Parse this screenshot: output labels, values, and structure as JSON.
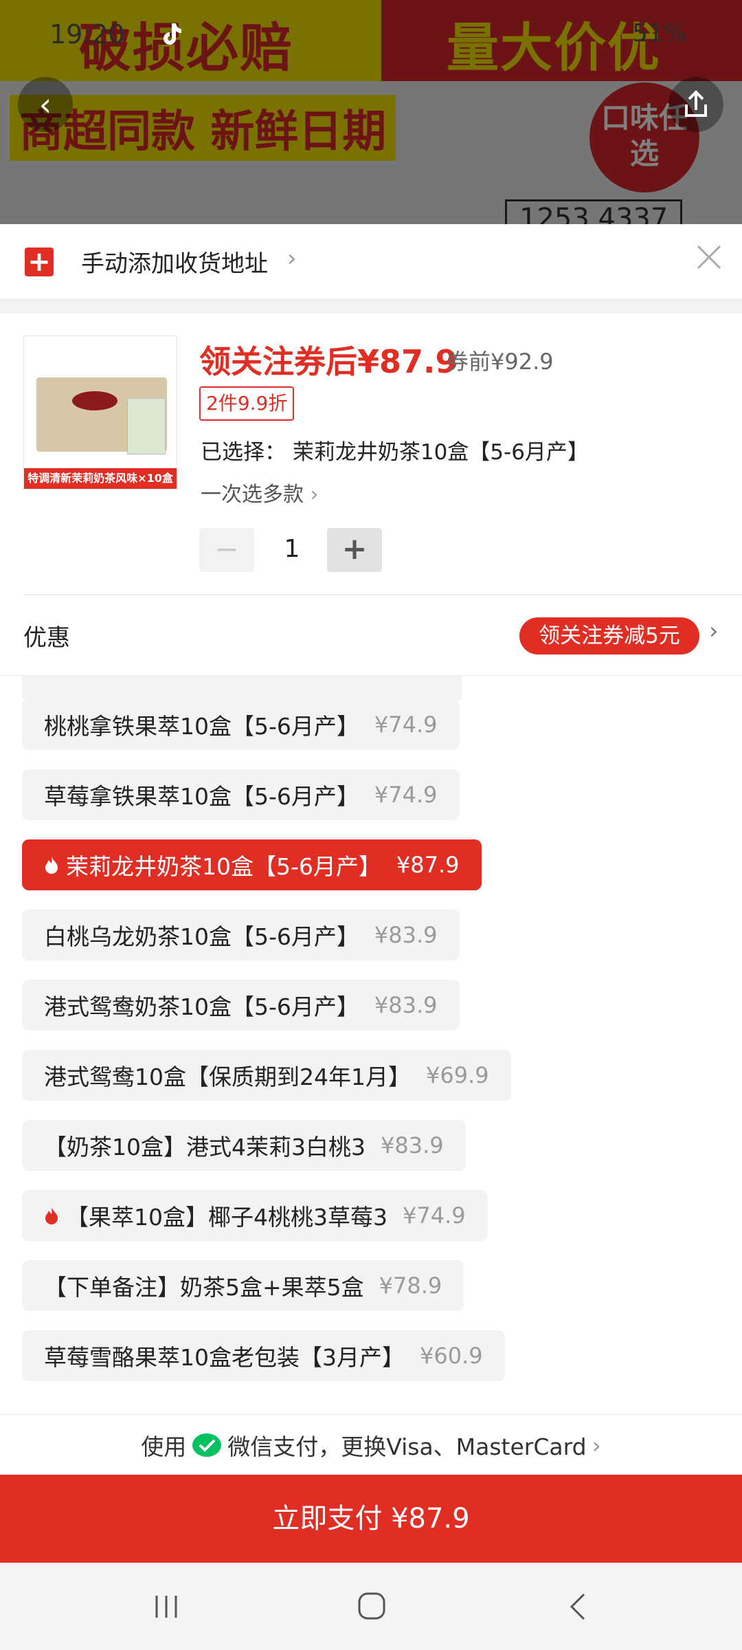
{
  "status_bar": {
    "time": "19:20",
    "battery": "51%"
  },
  "background": {
    "banner_left": "破损必赔",
    "banner_right": "量大价优",
    "slogan": "商超同款 新鲜日期",
    "badge_text": "口味任选",
    "box_code": "1253 4337"
  },
  "address": {
    "label": "手动添加收货地址"
  },
  "product": {
    "thumb_caption": "特调清新茉莉奶茶风味×10盒",
    "price_after_coupon": "领关注券后¥87.9",
    "price_before": "券前¥92.9",
    "discount_tag": "2件9.9折",
    "selected_label": "已选择：",
    "selected_value": "茉莉龙井奶茶10盒【5-6月产】",
    "multi_select": "一次选多款",
    "quantity": "1"
  },
  "promo": {
    "label": "优惠",
    "badge": "领关注券减5元"
  },
  "variants": [
    {
      "name": "桃桃拿铁果萃10盒【5-6月产】",
      "price": "¥74.9",
      "hot": false,
      "selected": false
    },
    {
      "name": "草莓拿铁果萃10盒【5-6月产】",
      "price": "¥74.9",
      "hot": false,
      "selected": false
    },
    {
      "name": "茉莉龙井奶茶10盒【5-6月产】",
      "price": "¥87.9",
      "hot": true,
      "selected": true
    },
    {
      "name": "白桃乌龙奶茶10盒【5-6月产】",
      "price": "¥83.9",
      "hot": false,
      "selected": false
    },
    {
      "name": "港式鸳鸯奶茶10盒【5-6月产】",
      "price": "¥83.9",
      "hot": false,
      "selected": false
    },
    {
      "name": "港式鸳鸯10盒【保质期到24年1月】",
      "price": "¥69.9",
      "hot": false,
      "selected": false
    },
    {
      "name": "【奶茶10盒】港式4茉莉3白桃3",
      "price": "¥83.9",
      "hot": false,
      "selected": false
    },
    {
      "name": "【果萃10盒】椰子4桃桃3草莓3",
      "price": "¥74.9",
      "hot": true,
      "selected": false
    },
    {
      "name": "【下单备注】奶茶5盒+果萃5盒",
      "price": "¥78.9",
      "hot": false,
      "selected": false
    },
    {
      "name": "草莓雪酪果萃10盒老包装【3月产】",
      "price": "¥60.9",
      "hot": false,
      "selected": false
    }
  ],
  "payment": {
    "prefix": "使用",
    "method": "微信支付，更换Visa、MasterCard",
    "button": "立即支付 ¥87.9"
  },
  "colors": {
    "accent": "#e02e24",
    "wechat_green": "#07c160"
  },
  "icons": [
    "tiktok-icon",
    "back-icon",
    "share-icon",
    "plus-icon",
    "close-icon",
    "chevron-right-icon",
    "flame-icon",
    "wechat-pay-icon",
    "recents-icon",
    "home-icon",
    "system-back-icon"
  ]
}
